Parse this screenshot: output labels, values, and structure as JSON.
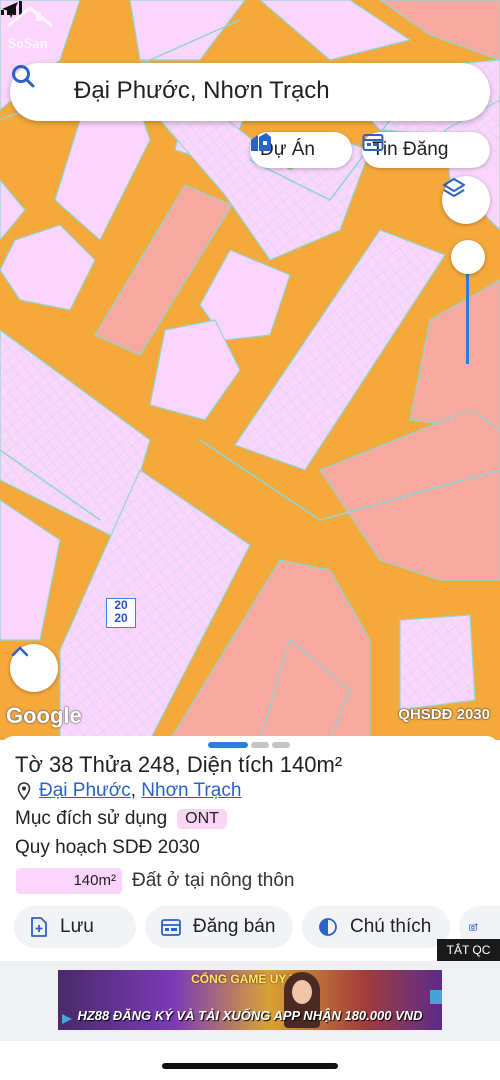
{
  "search": {
    "value": "Đại Phước, Nhơn Trạch"
  },
  "chips": {
    "du_an": "Dự Án",
    "tin_dang": "Tin Đăng"
  },
  "map": {
    "attribution": "Google",
    "layer_tag": "QHSDĐ 2030",
    "parcel_label": [
      "20",
      "20"
    ],
    "watermark": "SoSan",
    "colors": {
      "road": "#f6a93b",
      "residential": "#fbd5fc",
      "commercial": "#f7a9a0",
      "grid_line": "#8fd6d6"
    }
  },
  "parcel": {
    "title": "Tờ 38 Thửa 248, Diện tích 140m²",
    "commune": "Đại Phước",
    "separator": ", ",
    "district": "Nhơn Trạch",
    "purpose_label": "Mục đích sử dụng",
    "purpose_code": "ONT",
    "plan_title": "Quy hoạch SDĐ 2030",
    "plan_area": "140m²",
    "plan_desc": "Đất ở tại nông thôn"
  },
  "actions": {
    "save": "Lưu",
    "post_sale": "Đăng bán",
    "legend": "Chú thích"
  },
  "ad": {
    "close_label": "TẮT QC",
    "banner_top": "CỔNG GAME UY TÍN",
    "banner_text": "HZ88 ĐĂNG KÝ VÀ TẢI XUỐNG APP NHẬN 180.000 VND"
  },
  "accent": "#2a7de1"
}
